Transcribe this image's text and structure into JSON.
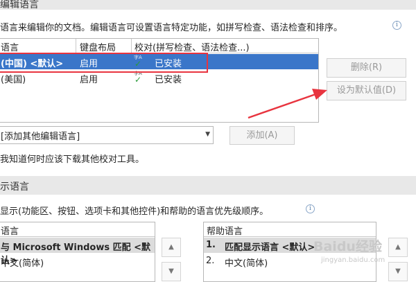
{
  "edit_language": {
    "header_title": "编辑语言",
    "description": "语言来编辑你的文档。编辑语言可设置语言特定功能，如拼写检查、语法检查和排序。",
    "info_glyph": "i",
    "columns": [
      "语言",
      "键盘布局",
      "校对(拼写检查、语法检查...)"
    ],
    "rows": [
      {
        "language": "(中国) <默认>",
        "keyboard": "启用",
        "proofing_mark": "字A",
        "proofing": "已安装",
        "selected": true
      },
      {
        "language": "(美国)",
        "keyboard": "启用",
        "proofing_mark": "字A",
        "proofing": "已安装",
        "selected": false
      }
    ],
    "delete_button": "删除(R)",
    "set_default_button": "设为默认值(D)",
    "add_combo_value": "[添加其他编辑语言]",
    "add_button": "添加(A)",
    "proofing_tools_link": "我知道何时应该下载其他校对工具。"
  },
  "display_language": {
    "header_title": "示语言",
    "description": "显示(功能区、按钮、选项卡和其他控件)和帮助的语言优先级顺序。",
    "info_glyph": "i",
    "display_list": {
      "header": "语言",
      "items": [
        "与 Microsoft Windows 匹配 <默认>",
        "中文(简体)"
      ]
    },
    "help_list": {
      "header": "帮助语言",
      "items": [
        {
          "num": "1.",
          "text": "匹配显示语言 <默认>"
        },
        {
          "num": "2.",
          "text": "中文(简体)"
        }
      ]
    },
    "spin_up": "▲",
    "spin_down": "▼"
  },
  "watermark": {
    "brand": "Baidu经验",
    "url": "jingyan.baidu.com"
  },
  "colors": {
    "selection": "#3a76c9",
    "annotation_red": "#e8343f",
    "check_green": "#2a9a3a"
  }
}
